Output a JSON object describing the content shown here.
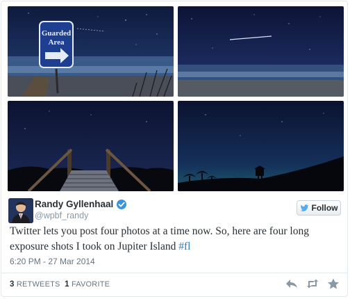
{
  "photos": [
    {
      "sign_line1": "Guarded",
      "sign_line2": "Area"
    },
    {},
    {},
    {}
  ],
  "author": {
    "name": "Randy Gyllenhaal",
    "handle": "@wpbf_randy"
  },
  "follow_label": "Follow",
  "tweet": {
    "text": "Twitter lets you post four photos at a time now. So, here are four long exposure shots I took on Jupiter Island ",
    "hashtag": "#fl"
  },
  "timestamp": "6:20 PM - 27 Mar 2014",
  "stats": {
    "retweets_count": "3",
    "retweets_label": "RETWEETS",
    "favorites_count": "1",
    "favorites_label": "FAVORITE"
  },
  "icons": {
    "verified": "verified-badge-icon",
    "bird": "twitter-bird-icon",
    "reply": "reply-icon",
    "retweet": "retweet-icon",
    "favorite": "star-icon"
  },
  "colors": {
    "link": "#2b7bb9",
    "verified": "#3b94d9",
    "follow_bird": "#55acee"
  }
}
